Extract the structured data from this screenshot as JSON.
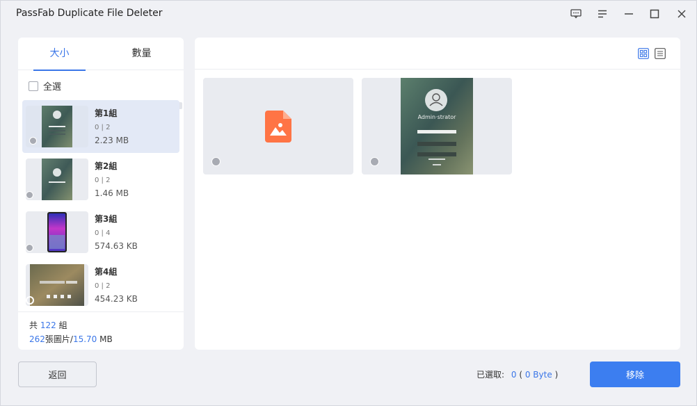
{
  "app": {
    "title": "PassFab Duplicate File Deleter"
  },
  "window_controls": [
    "feedback-icon",
    "menu-icon",
    "minimize-icon",
    "maximize-icon",
    "close-icon"
  ],
  "tabs": [
    {
      "label": "大小",
      "active": true
    },
    {
      "label": "數量",
      "active": false
    }
  ],
  "select_all_label": "全選",
  "groups": [
    {
      "name": "第1組",
      "count": "0 | 2",
      "size": "2.23 MB",
      "selected": true,
      "thumb": "login-screen"
    },
    {
      "name": "第2組",
      "count": "0 | 2",
      "size": "1.46 MB",
      "selected": false,
      "thumb": "login-screen"
    },
    {
      "name": "第3組",
      "count": "0 | 4",
      "size": "574.63 KB",
      "selected": false,
      "thumb": "phone-screen"
    },
    {
      "name": "第4組",
      "count": "0 | 2",
      "size": "454.23 KB",
      "selected": false,
      "thumb": "desktop-screen"
    }
  ],
  "summary": {
    "prefix": "共",
    "groups_count": "122",
    "groups_unit": "組",
    "images_count": "262",
    "images_unit": "張圖片/",
    "total_size": "15.70",
    "size_unit": "MB"
  },
  "view_modes": [
    "grid-view-icon",
    "list-view-icon"
  ],
  "files": [
    {
      "type": "image-placeholder"
    },
    {
      "type": "login-screen",
      "text": "Admin·strator"
    }
  ],
  "bottom": {
    "back_label": "返回",
    "selected_label": "已選取:",
    "selected_count": "0",
    "selected_open": "(",
    "selected_bytes": "0 Byte",
    "selected_close": ")",
    "remove_label": "移除"
  },
  "colors": {
    "accent": "#3a76e8",
    "placeholder_icon": "#ff7445"
  }
}
